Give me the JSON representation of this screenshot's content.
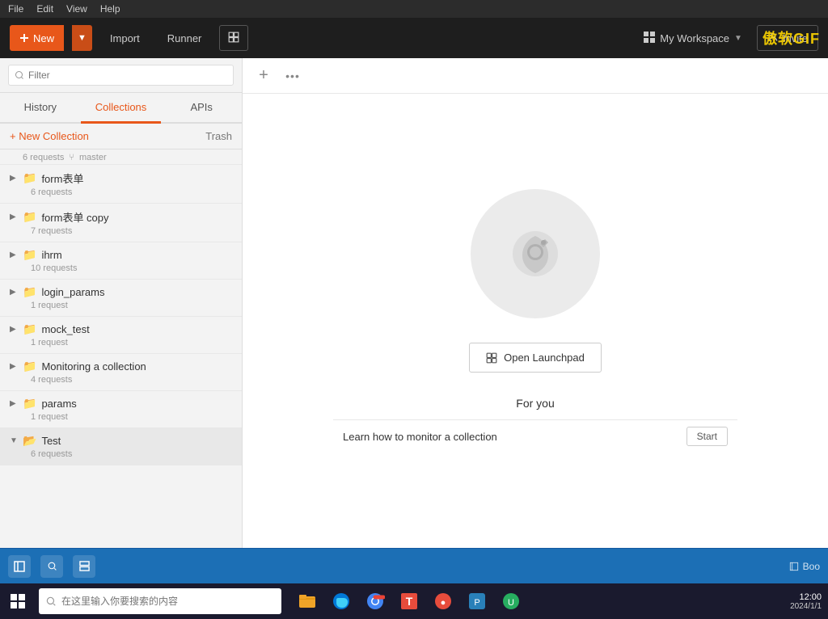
{
  "menuBar": {
    "items": [
      "File",
      "Edit",
      "View",
      "Help"
    ]
  },
  "header": {
    "newButton": "New",
    "importButton": "Import",
    "runnerButton": "Runner",
    "workspaceName": "My Workspace",
    "inviteButton": "Invite",
    "brandLogo": "傲软GIF"
  },
  "sidebar": {
    "searchPlaceholder": "Filter",
    "tabs": [
      "History",
      "Collections",
      "APIs"
    ],
    "activeTab": "Collections",
    "newCollectionLabel": "+ New Collection",
    "trashLabel": "Trash",
    "collections": [
      {
        "name": "form表单",
        "requests": "6 requests",
        "branch": "master",
        "expanded": false,
        "showBranch": true
      },
      {
        "name": "form表单 copy",
        "requests": "7 requests",
        "branch": null,
        "expanded": false,
        "showBranch": false
      },
      {
        "name": "ihrm",
        "requests": "10 requests",
        "branch": null,
        "expanded": false,
        "showBranch": false
      },
      {
        "name": "login_params",
        "requests": "1 request",
        "branch": null,
        "expanded": false,
        "showBranch": false
      },
      {
        "name": "mock_test",
        "requests": "1 request",
        "branch": null,
        "expanded": false,
        "showBranch": false
      },
      {
        "name": "Monitoring a collection",
        "requests": "4 requests",
        "branch": null,
        "expanded": false,
        "showBranch": false
      },
      {
        "name": "params",
        "requests": "1 request",
        "branch": null,
        "expanded": false,
        "showBranch": false
      },
      {
        "name": "Test",
        "requests": "6 requests",
        "branch": null,
        "expanded": true,
        "showBranch": false,
        "active": true
      }
    ]
  },
  "content": {
    "openLaunchpadLabel": "Open Launchpad",
    "forYouTitle": "For you",
    "forYouItem": "Learn how to monitor a collection",
    "startLabel": "Start"
  },
  "bottomBar": {
    "bookLabel": "Boo"
  },
  "winTaskbar": {
    "searchPlaceholder": "在这里输入你要搜索的内容"
  }
}
